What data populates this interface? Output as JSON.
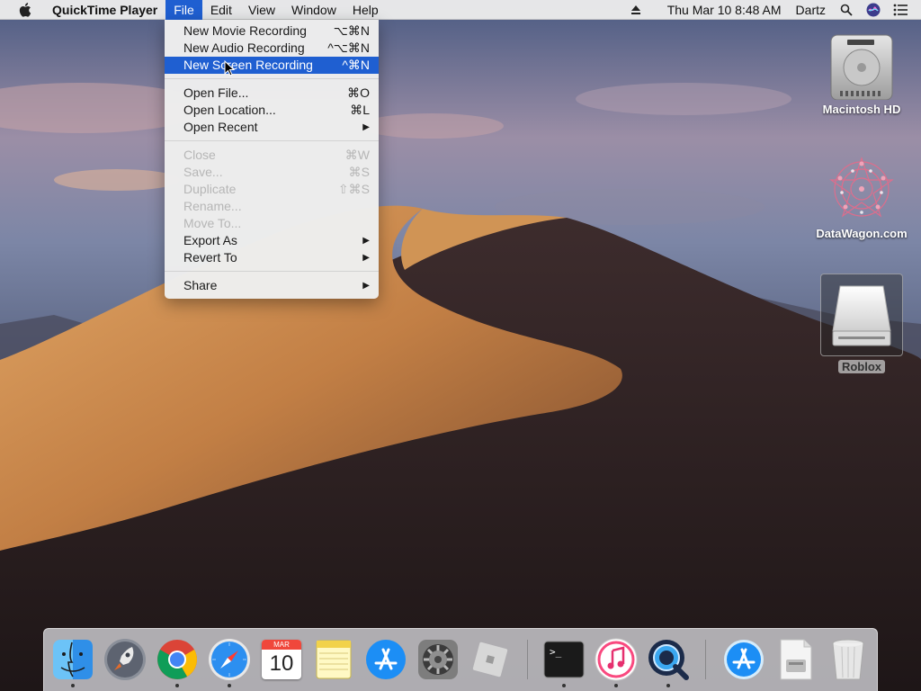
{
  "menubar": {
    "app_name": "QuickTime Player",
    "menus": [
      "File",
      "Edit",
      "View",
      "Window",
      "Help"
    ],
    "active_menu": "File",
    "clock": "Thu Mar 10  8:48 AM",
    "user": "Dartz",
    "icons": [
      "apple-icon",
      "eject-icon",
      "spotlight-icon",
      "siri-icon",
      "notification-center-icon"
    ]
  },
  "file_menu": {
    "items": [
      {
        "label": "New Movie Recording",
        "shortcut": "⌥⌘N",
        "enabled": true
      },
      {
        "label": "New Audio Recording",
        "shortcut": "^⌥⌘N",
        "enabled": true
      },
      {
        "label": "New Screen Recording",
        "shortcut": "^⌘N",
        "enabled": true,
        "highlighted": true
      },
      {
        "label": "Open File...",
        "shortcut": "⌘O",
        "enabled": true
      },
      {
        "label": "Open Location...",
        "shortcut": "⌘L",
        "enabled": true
      },
      {
        "label": "Open Recent",
        "shortcut": "▶",
        "enabled": true,
        "submenu": true
      },
      {
        "label": "Close",
        "shortcut": "⌘W",
        "enabled": false
      },
      {
        "label": "Save...",
        "shortcut": "⌘S",
        "enabled": false
      },
      {
        "label": "Duplicate",
        "shortcut": "⇧⌘S",
        "enabled": false
      },
      {
        "label": "Rename...",
        "shortcut": "",
        "enabled": false
      },
      {
        "label": "Move To...",
        "shortcut": "",
        "enabled": false
      },
      {
        "label": "Export As",
        "shortcut": "▶",
        "enabled": true,
        "submenu": true
      },
      {
        "label": "Revert To",
        "shortcut": "▶",
        "enabled": true,
        "submenu": true
      },
      {
        "label": "Share",
        "shortcut": "▶",
        "enabled": true,
        "submenu": true
      }
    ]
  },
  "desktop": {
    "icons": [
      {
        "label": "Macintosh HD",
        "icon": "hard-drive-icon"
      },
      {
        "label": "DataWagon.com",
        "icon": "datawagon-icon"
      },
      {
        "label": "Roblox",
        "icon": "disk-image-icon",
        "selected": true
      }
    ]
  },
  "dock": {
    "items": [
      {
        "name": "Finder",
        "icon": "finder-icon",
        "running": true
      },
      {
        "name": "Launchpad",
        "icon": "launchpad-icon",
        "running": false
      },
      {
        "name": "Google Chrome",
        "icon": "chrome-icon",
        "running": true
      },
      {
        "name": "Safari",
        "icon": "safari-icon",
        "running": true
      },
      {
        "name": "Calendar",
        "icon": "calendar-icon",
        "running": false,
        "month": "MAR",
        "day": "10"
      },
      {
        "name": "Notes",
        "icon": "notes-icon",
        "running": false
      },
      {
        "name": "App Store",
        "icon": "app-store-icon",
        "running": false
      },
      {
        "name": "System Preferences",
        "icon": "system-preferences-icon",
        "running": false
      },
      {
        "name": "Roblox",
        "icon": "roblox-icon",
        "running": false
      },
      {
        "name": "Terminal",
        "icon": "terminal-icon",
        "running": true
      },
      {
        "name": "iTunes",
        "icon": "itunes-icon",
        "running": true
      },
      {
        "name": "QuickTime Player",
        "icon": "quicktime-icon",
        "running": true
      },
      {
        "name": "Applications",
        "icon": "applications-folder-icon",
        "running": false
      },
      {
        "name": "Downloads",
        "icon": "downloads-stack-icon",
        "running": false
      },
      {
        "name": "Trash",
        "icon": "trash-icon",
        "running": false
      }
    ]
  },
  "colors": {
    "menu_highlight": "#1f5fd1",
    "disabled_text": "#b6b6b6"
  }
}
